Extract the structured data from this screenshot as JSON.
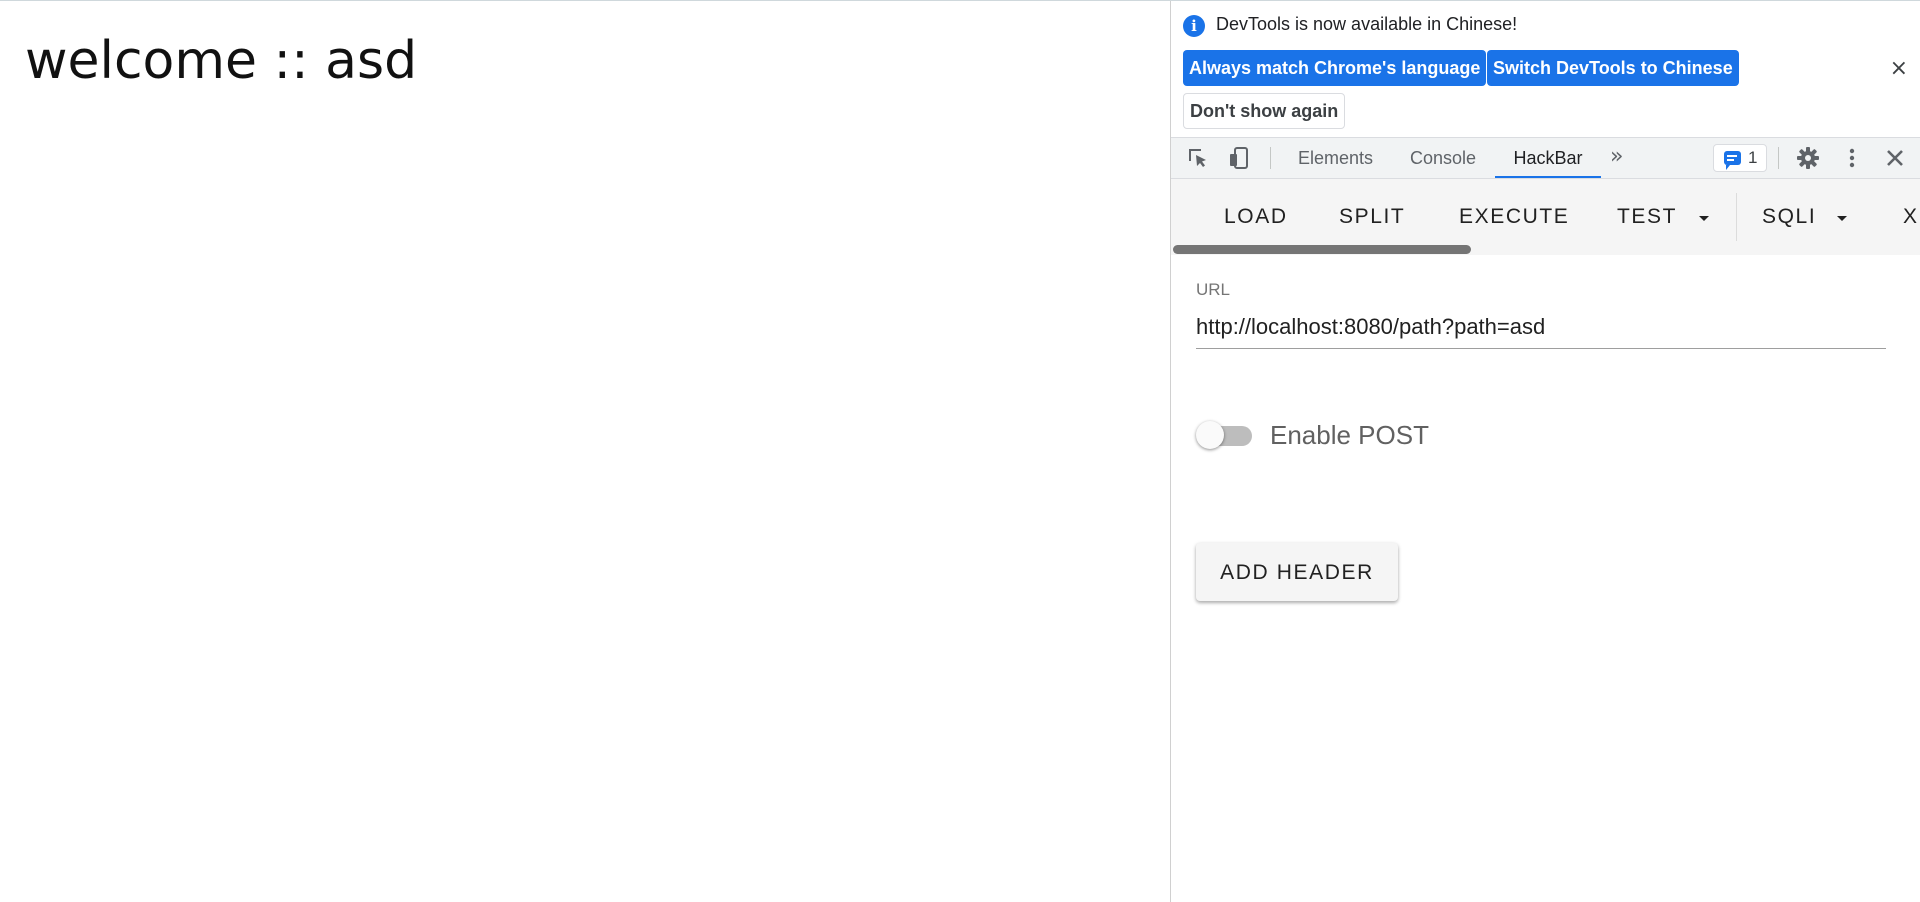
{
  "page": {
    "heading": "welcome :: asd"
  },
  "devtools": {
    "banner": {
      "message": "DevTools is now available in Chinese!",
      "buttons": {
        "match_language": "Always match Chrome's language",
        "switch_chinese": "Switch DevTools to Chinese",
        "dont_show": "Don't show again"
      },
      "close": "×"
    },
    "tabs": [
      {
        "label": "Elements",
        "active": false
      },
      {
        "label": "Console",
        "active": false
      },
      {
        "label": "HackBar",
        "active": true
      }
    ],
    "more_tabs": "»",
    "issues_count": "1",
    "hackbar": {
      "menu": {
        "load": "LOAD",
        "split": "SPLIT",
        "execute": "EXECUTE",
        "test": "TEST",
        "sqli": "SQLI",
        "next_partial": "X"
      },
      "url_label": "URL",
      "url_value": "http://localhost:8080/path?path=asd",
      "enable_post_label": "Enable POST",
      "enable_post_on": false,
      "add_header_label": "ADD HEADER"
    },
    "colors": {
      "accent": "#1a73e8",
      "toolbar_bg": "#f1f3f4",
      "hackbar_menu_bg": "#f5f5f5"
    }
  }
}
